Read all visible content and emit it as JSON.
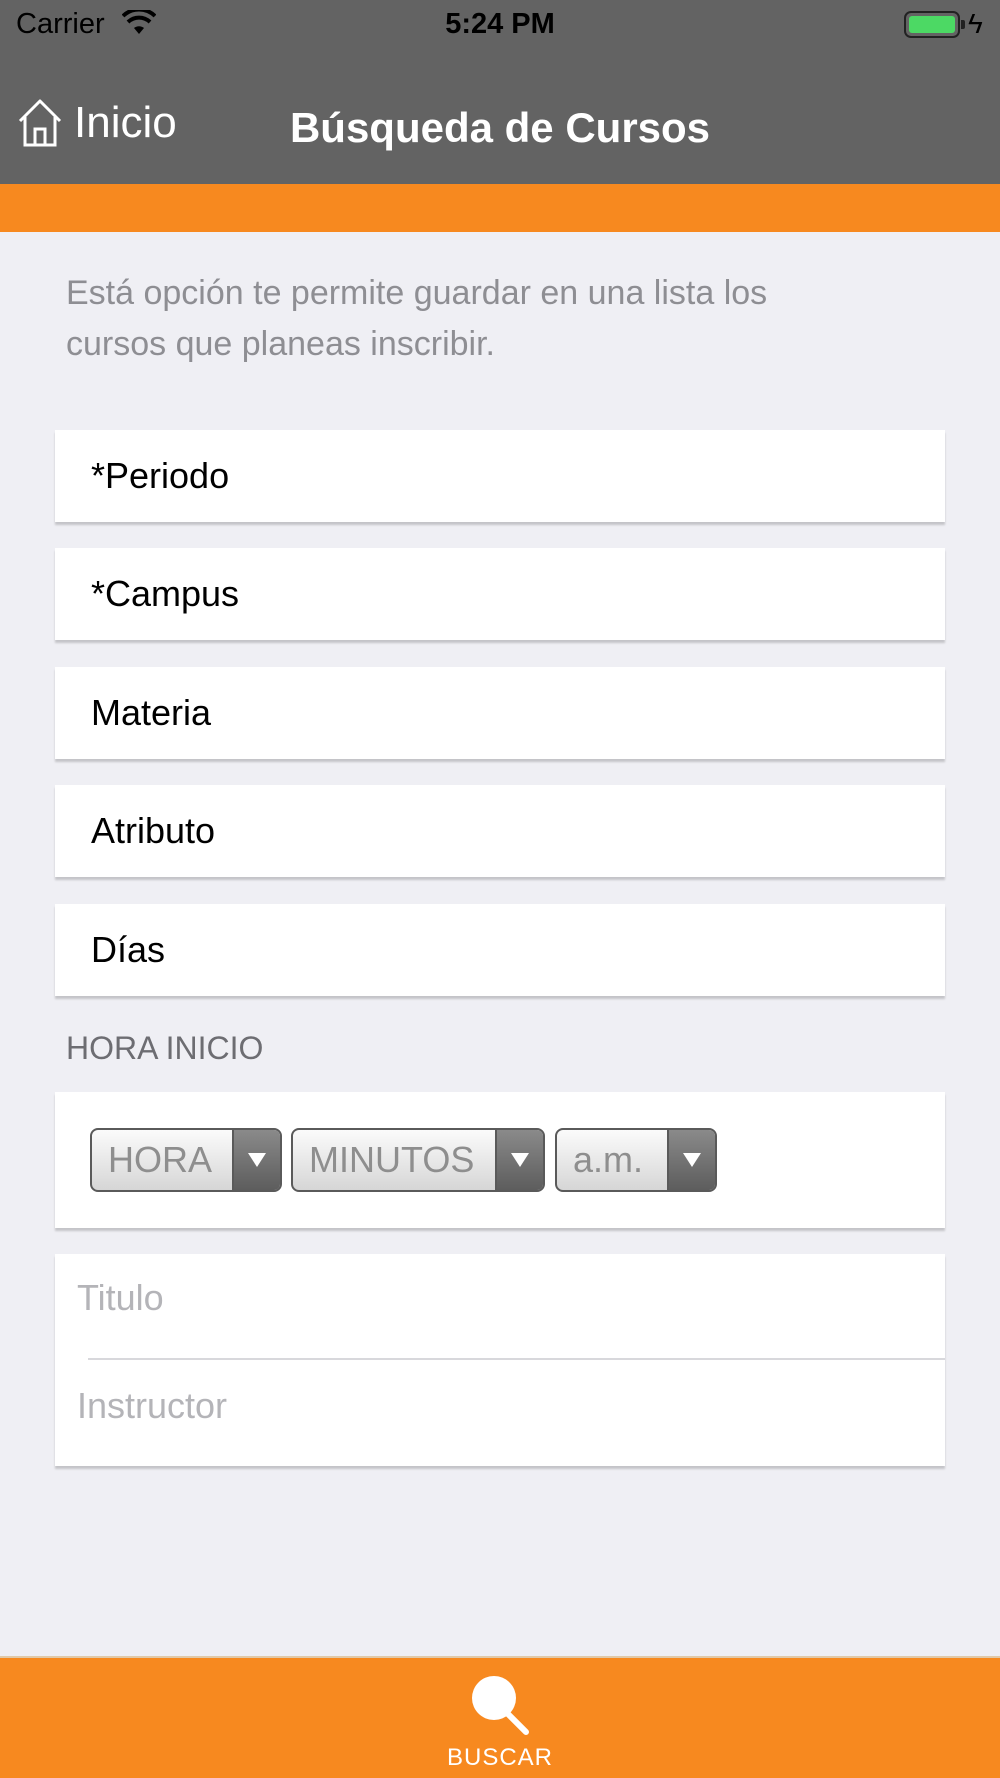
{
  "status_bar": {
    "carrier": "Carrier",
    "time": "5:24 PM",
    "battery_level": 1.0
  },
  "nav": {
    "back_label": "Inicio",
    "back_icon": "home-icon",
    "title": "Búsqueda de Cursos"
  },
  "intro_text": "Está opción te permite guardar en una lista los cursos que planeas inscribir.",
  "fields": {
    "periodo": "*Periodo",
    "campus": "*Campus",
    "materia": "Materia",
    "atributo": "Atributo",
    "dias": "Días"
  },
  "hora_inicio": {
    "label": "HORA INICIO",
    "hour_select": "HORA",
    "minutes_select": "MINUTOS",
    "ampm_select": "a.m."
  },
  "text_inputs": {
    "titulo_placeholder": "Titulo",
    "instructor_placeholder": "Instructor"
  },
  "tabbar": {
    "search_label": "BUSCAR",
    "search_icon": "search-icon"
  },
  "colors": {
    "nav_bg": "#636363",
    "accent_orange": "#f7891f",
    "page_bg": "#efeff4"
  }
}
